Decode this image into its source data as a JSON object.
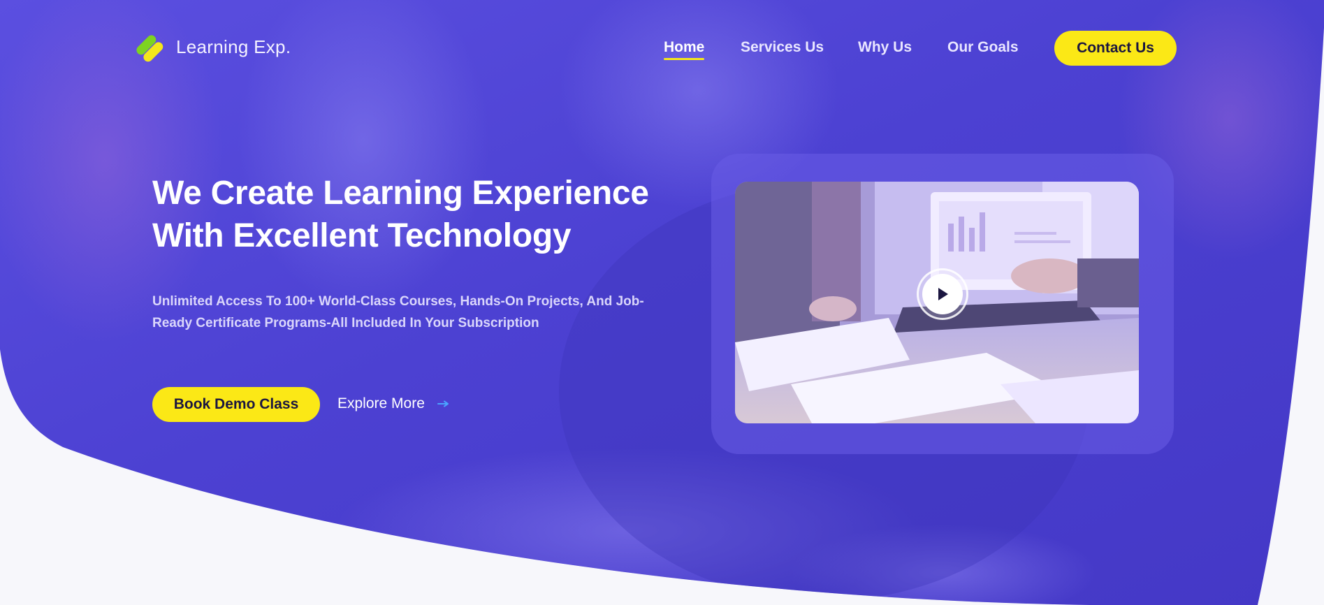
{
  "brand": {
    "name": "Learning Exp.",
    "logo_colors": [
      "#7ed321",
      "#f5e71a"
    ]
  },
  "nav": {
    "items": [
      {
        "label": "Home",
        "active": true
      },
      {
        "label": "Services Us",
        "active": false
      },
      {
        "label": "Why Us",
        "active": false
      },
      {
        "label": "Our Goals",
        "active": false
      }
    ],
    "cta_label": "Contact Us"
  },
  "hero": {
    "headline_line1": "We Create Learning Experience",
    "headline_line2": "With Excellent Technology",
    "subtext_line1": "Unlimited Access To 100+ World-Class Courses, Hands-On Projects, And Job-",
    "subtext_line2": "Ready Certificate Programs-All Included In Your Subscription",
    "primary_button": "Book Demo Class",
    "secondary_link": "Explore More",
    "secondary_icon": "arrow-right-icon"
  },
  "video": {
    "play_icon": "play-icon"
  },
  "colors": {
    "hero_overlay": "#4a3fd0",
    "accent_yellow": "#fbe816",
    "page_background": "#f7f7fb",
    "text_dark": "#1b1640"
  }
}
